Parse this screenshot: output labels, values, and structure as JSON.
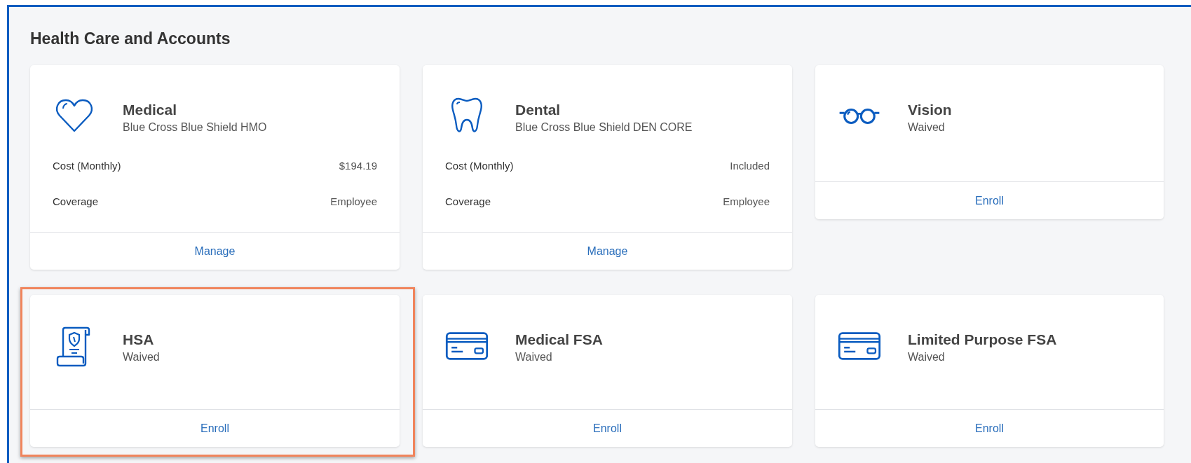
{
  "title": "Health Care and Accounts",
  "cards": [
    {
      "name": "Medical",
      "plan": "Blue Cross Blue Shield HMO",
      "details": [
        {
          "label": "Cost (Monthly)",
          "value": "$194.19"
        },
        {
          "label": "Coverage",
          "value": "Employee"
        }
      ],
      "action": "Manage",
      "highlighted": false
    },
    {
      "name": "Dental",
      "plan": "Blue Cross Blue Shield DEN CORE",
      "details": [
        {
          "label": "Cost (Monthly)",
          "value": "Included"
        },
        {
          "label": "Coverage",
          "value": "Employee"
        }
      ],
      "action": "Manage",
      "highlighted": false
    },
    {
      "name": "Vision",
      "plan": "Waived",
      "action": "Enroll",
      "highlighted": false
    },
    {
      "name": "HSA",
      "plan": "Waived",
      "action": "Enroll",
      "highlighted": true
    },
    {
      "name": "Medical FSA",
      "plan": "Waived",
      "action": "Enroll",
      "highlighted": false
    },
    {
      "name": "Limited Purpose FSA",
      "plan": "Waived",
      "action": "Enroll",
      "highlighted": false
    }
  ]
}
